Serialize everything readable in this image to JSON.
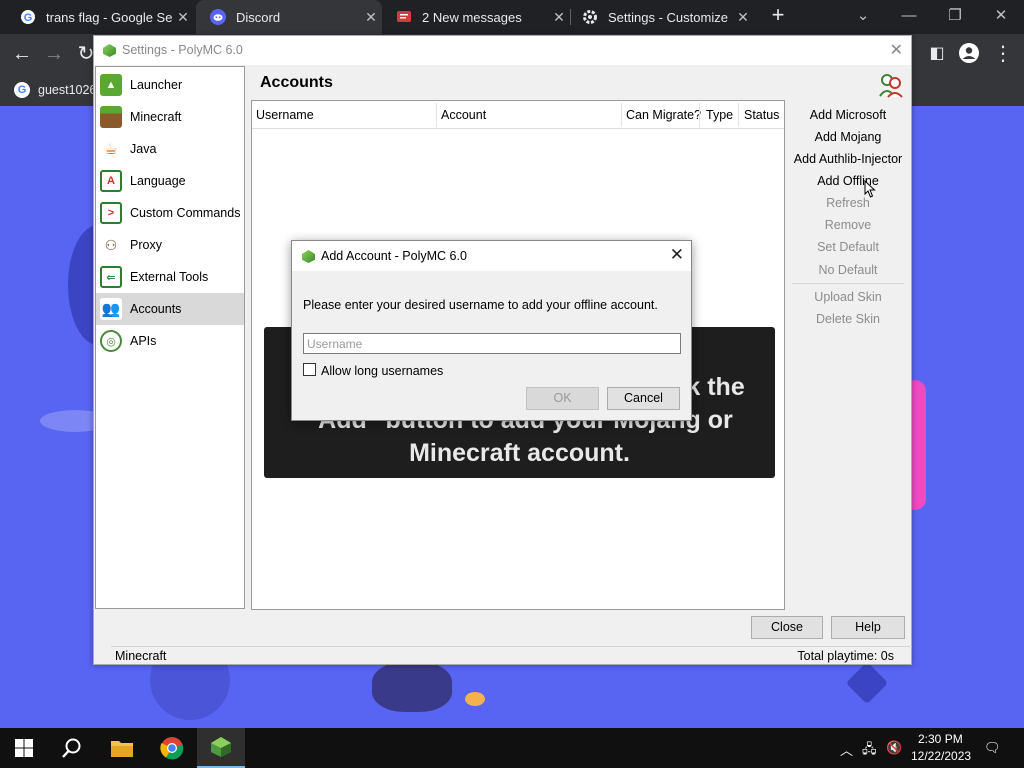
{
  "browser": {
    "tabs": [
      {
        "title": "trans flag - Google Sea",
        "icon": "google-icon",
        "active": false
      },
      {
        "title": "Discord",
        "icon": "discord-icon",
        "active": true
      },
      {
        "title": "2 New messages",
        "icon": "messages-icon",
        "active": false
      },
      {
        "title": "Settings - Customize p",
        "icon": "gear-icon",
        "active": false
      }
    ],
    "new_tab": "+",
    "bookmark": "guest1026"
  },
  "settings_window": {
    "title": "Settings - PolyMC 6.0",
    "close": "✕",
    "sidebar": [
      {
        "label": "Launcher",
        "icon": "launcher-icon",
        "color": "#5aa832"
      },
      {
        "label": "Minecraft",
        "icon": "minecraft-icon",
        "color": "#8b5a2b"
      },
      {
        "label": "Java",
        "icon": "java-icon",
        "color": "#e76f00"
      },
      {
        "label": "Language",
        "icon": "language-icon",
        "color": "#c0392b"
      },
      {
        "label": "Custom Commands",
        "icon": "terminal-icon",
        "color": "#2e7d32"
      },
      {
        "label": "Proxy",
        "icon": "proxy-icon",
        "color": "#7a5230"
      },
      {
        "label": "External Tools",
        "icon": "tools-icon",
        "color": "#2e7d32"
      },
      {
        "label": "Accounts",
        "icon": "accounts-icon",
        "color": "#4a6e8a",
        "selected": true
      },
      {
        "label": "APIs",
        "icon": "api-icon",
        "color": "#4b8a3a"
      }
    ],
    "page_title": "Accounts",
    "table_columns": [
      "Username",
      "Account",
      "Can Migrate?",
      "Type",
      "Status"
    ],
    "banner_lines": [
      "If you don't have an account, click the",
      "\"Add\" button to add your Mojang or",
      "Minecraft account."
    ],
    "actions": [
      {
        "label": "Add Microsoft",
        "enabled": true
      },
      {
        "label": "Add Mojang",
        "enabled": true
      },
      {
        "label": "Add Authlib-Injector",
        "enabled": true
      },
      {
        "label": "Add Offline",
        "enabled": true
      },
      {
        "label": "Refresh",
        "enabled": false
      },
      {
        "label": "Remove",
        "enabled": false
      },
      {
        "label": "Set Default",
        "enabled": false
      },
      {
        "label": "No Default",
        "enabled": false
      },
      {
        "label": "Upload Skin",
        "enabled": false
      },
      {
        "label": "Delete Skin",
        "enabled": false
      }
    ],
    "close_button": "Close",
    "help_button": "Help",
    "status_left": "Minecraft",
    "status_right": "Total playtime: 0s"
  },
  "dialog": {
    "title": "Add Account - PolyMC 6.0",
    "close": "✕",
    "message": "Please enter your desired username to add your offline account.",
    "username_placeholder": "Username",
    "username_value": "",
    "allow_long_label": "Allow long usernames",
    "allow_long_checked": false,
    "ok_button": "OK",
    "ok_enabled": false,
    "cancel_button": "Cancel"
  },
  "taskbar": {
    "apps": [
      "windows-start-icon",
      "search-icon",
      "file-explorer-icon",
      "chrome-icon",
      "polymc-icon"
    ],
    "time": "2:30 PM",
    "date": "12/22/2023"
  }
}
